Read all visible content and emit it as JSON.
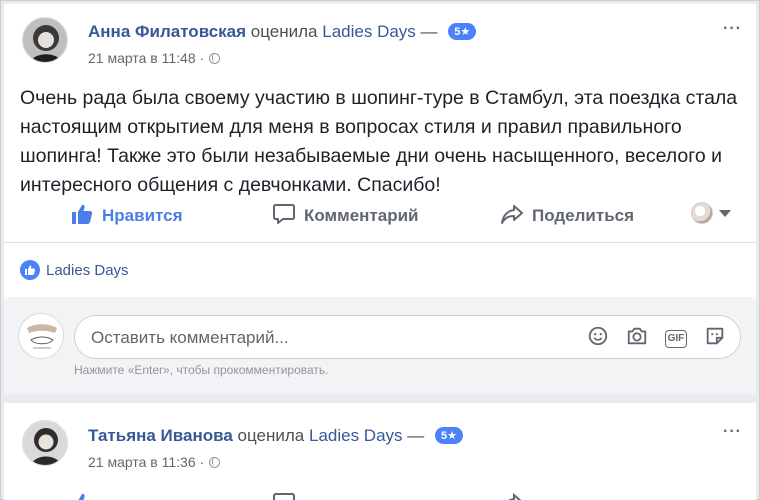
{
  "posts": [
    {
      "author": "Анна Филатовская",
      "verb": "оценила",
      "page": "Ladies Days",
      "dash": "—",
      "rating": "5★",
      "timestamp": "21 марта в 11:48 ·",
      "text": "Очень рада была своему участию в шопинг-туре в Стамбул, эта поездка стала настоящим открытием для меня в вопросах стиля и правил правильного шопинга! Также это были незабываемые дни очень насыщенного, веселого и интересного общения с девчонками. Спасибо!",
      "more": "···"
    },
    {
      "author": "Татьяна Иванова",
      "verb": "оценила",
      "page": "Ladies Days",
      "dash": "—",
      "rating": "5★",
      "timestamp": "21 марта в 11:36 ·",
      "more": "···"
    }
  ],
  "actions": {
    "like": "Нравится",
    "comment": "Комментарий",
    "share": "Поделиться"
  },
  "likes": {
    "label": "Ladies Days"
  },
  "comment_box": {
    "placeholder": "Оставить комментарий...",
    "hint": "Нажмите «Enter», чтобы прокомментировать."
  },
  "icons": {
    "like": "thumbs-up-icon",
    "comment": "speech-bubble-icon",
    "share": "share-arrow-icon",
    "emoji": "smiley-icon",
    "camera": "camera-icon",
    "gif": "gif-icon",
    "sticker": "sticker-icon",
    "privacy": "globe-icon"
  },
  "colors": {
    "link": "#385898",
    "accent": "#4c82f7",
    "background": "#e9ebee"
  }
}
